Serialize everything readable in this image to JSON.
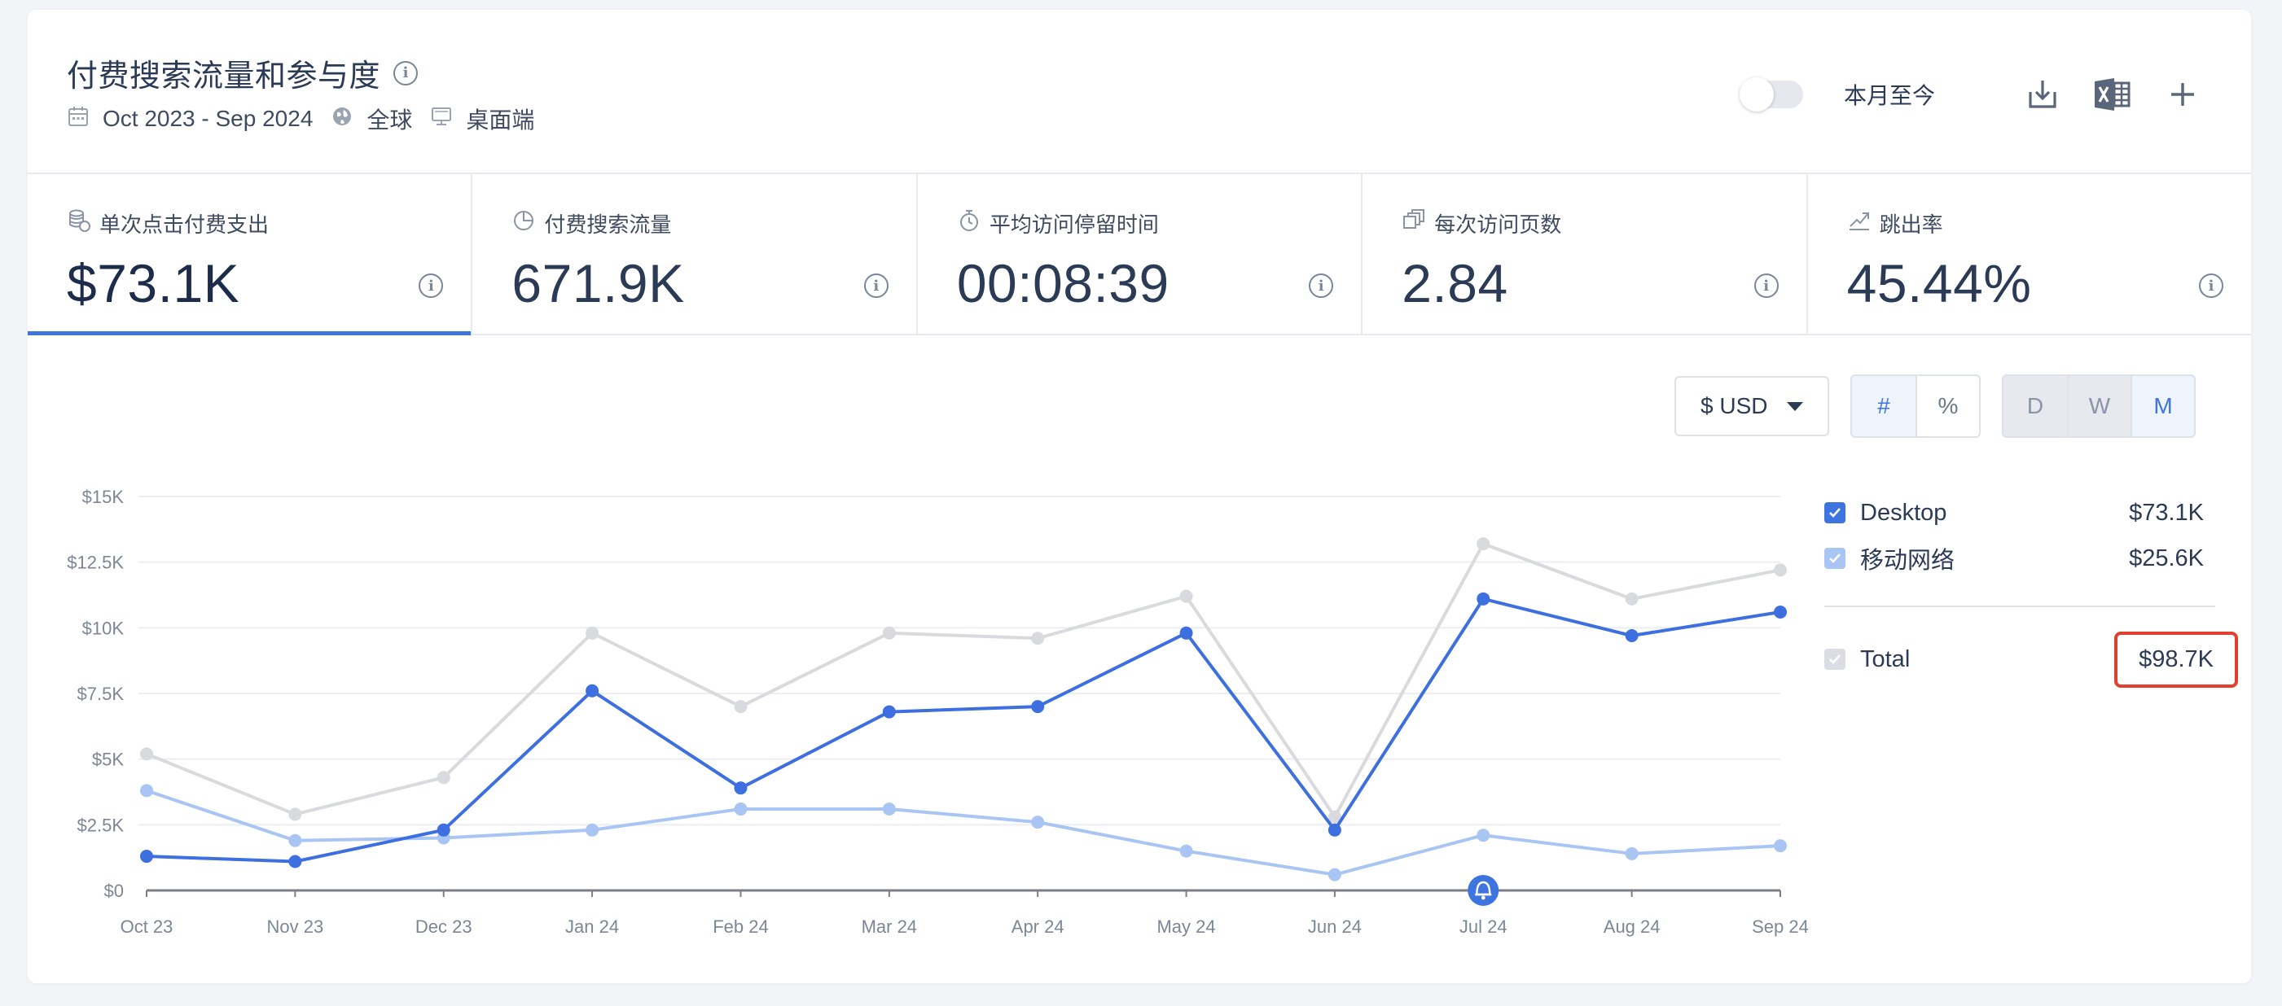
{
  "header": {
    "title": "付费搜索流量和参与度",
    "date_range": "Oct 2023 - Sep 2024",
    "region": "全球",
    "device": "桌面端",
    "ytd_label": "本月至今",
    "icons": [
      "calendar-icon",
      "globe-icon",
      "desktop-icon",
      "download-icon",
      "excel-icon",
      "plus-icon"
    ]
  },
  "metrics": [
    {
      "label": "单次点击付费支出",
      "value": "$73.1K",
      "icon": "coins-icon",
      "active": true
    },
    {
      "label": "付费搜索流量",
      "value": "671.9K",
      "icon": "pie-chart-icon",
      "active": false
    },
    {
      "label": "平均访问停留时间",
      "value": "00:08:39",
      "icon": "stopwatch-icon",
      "active": false
    },
    {
      "label": "每次访问页数",
      "value": "2.84",
      "icon": "pages-icon",
      "active": false
    },
    {
      "label": "跳出率",
      "value": "45.44%",
      "icon": "bounce-arrow-icon",
      "active": false
    }
  ],
  "controls": {
    "currency": "$ USD",
    "unit_options": [
      "#",
      "%"
    ],
    "unit_selected": "#",
    "period_options": [
      "D",
      "W",
      "M"
    ],
    "period_selected": "M"
  },
  "colors": {
    "accent": "#3e74e0",
    "desktop_series": "#3e6fe0",
    "mobile_series": "#a9c5f3",
    "total_series": "#d9dade",
    "highlight_box": "#e0402d"
  },
  "legend": {
    "items": [
      {
        "name": "Desktop",
        "value": "$73.1K",
        "checkbox": "blue"
      },
      {
        "name": "移动网络",
        "value": "$25.6K",
        "checkbox": "lightblue"
      }
    ],
    "total": {
      "name": "Total",
      "value": "$98.7K"
    }
  },
  "chart_data": {
    "type": "line",
    "categories": [
      "Oct 23",
      "Nov 23",
      "Dec 23",
      "Jan 24",
      "Feb 24",
      "Mar 24",
      "Apr 24",
      "May 24",
      "Jun 24",
      "Jul 24",
      "Aug 24",
      "Sep 24"
    ],
    "y_ticks": [
      "$0",
      "$2.5K",
      "$5K",
      "$7.5K",
      "$10K",
      "$12.5K",
      "$15K"
    ],
    "ylim": [
      0,
      15000
    ],
    "series": [
      {
        "name": "Total",
        "values": [
          5200,
          2900,
          4300,
          9800,
          7000,
          9800,
          9600,
          11200,
          2800,
          13200,
          11100,
          12200
        ]
      },
      {
        "name": "移动网络",
        "values": [
          3800,
          1900,
          2000,
          2300,
          3100,
          3100,
          2600,
          1500,
          600,
          2100,
          1400,
          1700
        ]
      },
      {
        "name": "Desktop",
        "values": [
          1300,
          1100,
          2300,
          7600,
          3900,
          6800,
          7000,
          9800,
          2300,
          11100,
          9700,
          10600
        ]
      }
    ],
    "annotation": {
      "category": "Jul 24",
      "icon": "bell-icon"
    },
    "grid": true,
    "legend": "right"
  }
}
